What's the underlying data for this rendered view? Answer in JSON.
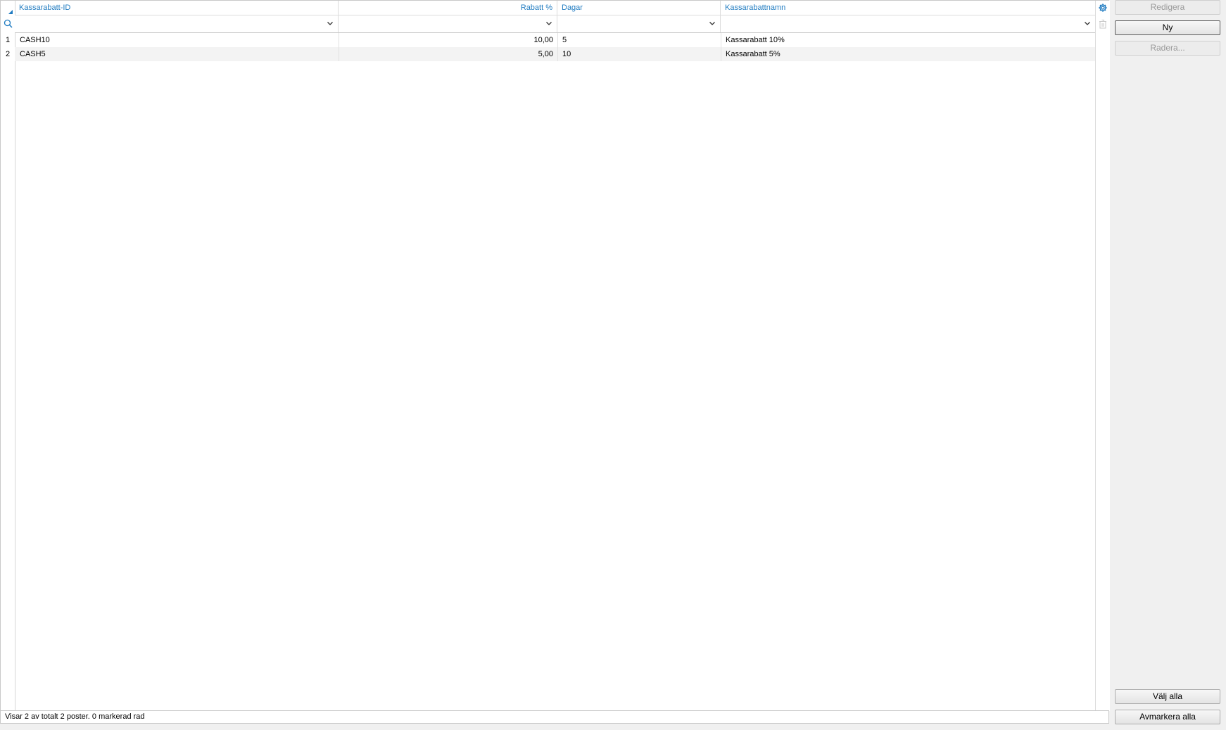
{
  "grid": {
    "columns": [
      {
        "label": "Kassarabatt-ID",
        "align": "left"
      },
      {
        "label": "Rabatt %",
        "align": "right"
      },
      {
        "label": "Dagar",
        "align": "left"
      },
      {
        "label": "Kassarabattnamn",
        "align": "left"
      }
    ],
    "rows": [
      {
        "num": "1",
        "id": "CASH10",
        "rabatt": "10,00",
        "dagar": "5",
        "namn": "Kassarabatt 10%"
      },
      {
        "num": "2",
        "id": "CASH5",
        "rabatt": "5,00",
        "dagar": "10",
        "namn": "Kassarabatt 5%"
      }
    ]
  },
  "status": {
    "text": "Visar 2 av totalt 2 poster. 0 markerad rad"
  },
  "buttons": {
    "edit": "Redigera",
    "new": "Ny",
    "delete": "Radera...",
    "select_all": "Välj alla",
    "deselect_all": "Avmarkera alla"
  },
  "colors": {
    "accent": "#1f7bc1",
    "alt_row": "#f3f3f3"
  }
}
